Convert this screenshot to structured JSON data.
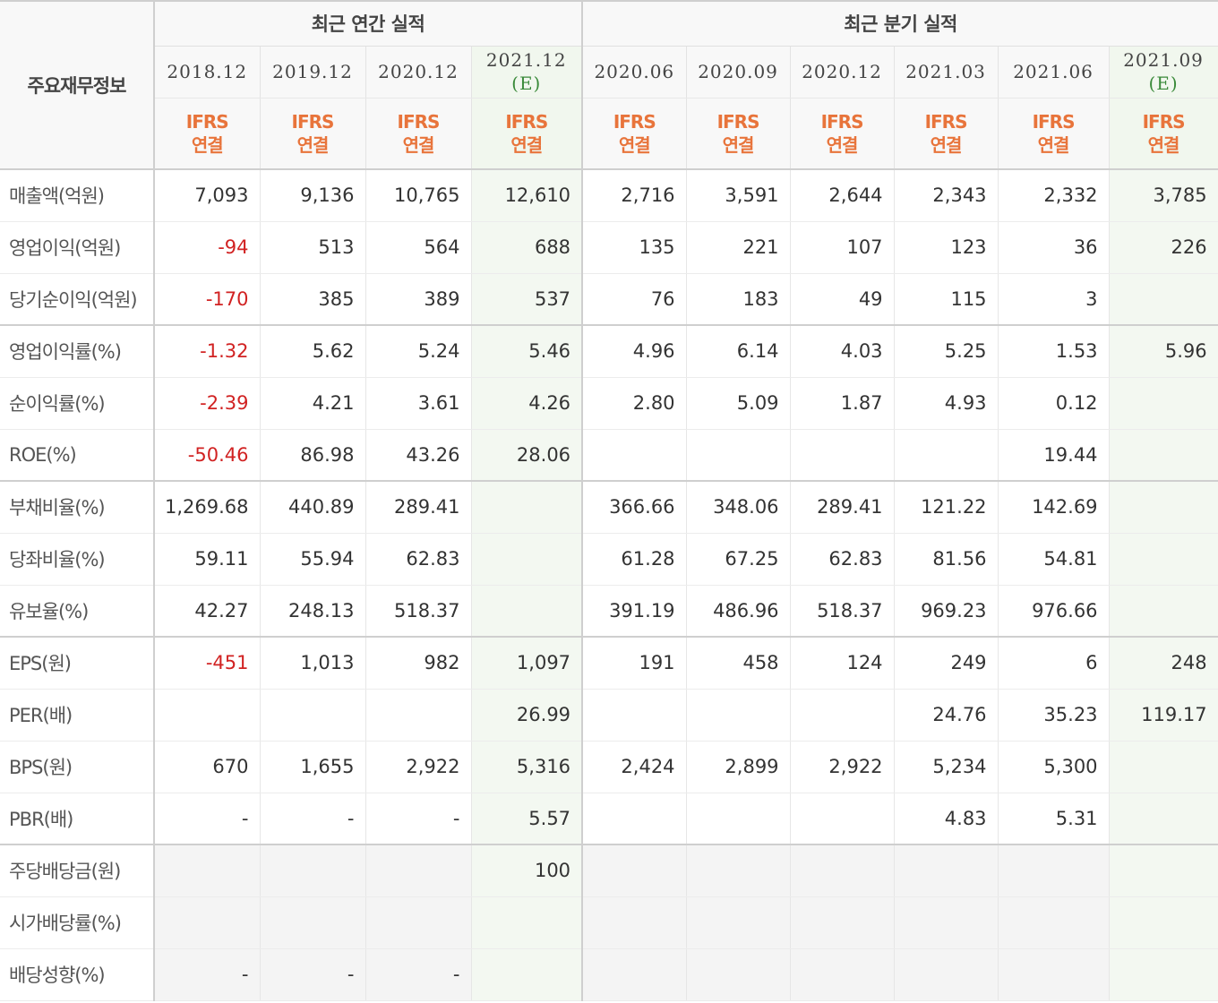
{
  "header": {
    "label": "주요재무정보",
    "annual_group": "최근 연간 실적",
    "quarterly_group": "최근 분기 실적",
    "ifrs_line1": "IFRS",
    "ifrs_line2": "연결",
    "periods": [
      {
        "date": "2018.12",
        "est": ""
      },
      {
        "date": "2019.12",
        "est": ""
      },
      {
        "date": "2020.12",
        "est": ""
      },
      {
        "date": "2021.12",
        "est": "(E)"
      },
      {
        "date": "2020.06",
        "est": ""
      },
      {
        "date": "2020.09",
        "est": ""
      },
      {
        "date": "2020.12",
        "est": ""
      },
      {
        "date": "2021.03",
        "est": ""
      },
      {
        "date": "2021.06",
        "est": ""
      },
      {
        "date": "2021.09",
        "est": "(E)"
      }
    ]
  },
  "rows": [
    {
      "label": "매출액(억원)",
      "values": [
        "7,093",
        "9,136",
        "10,765",
        "12,610",
        "2,716",
        "3,591",
        "2,644",
        "2,343",
        "2,332",
        "3,785"
      ]
    },
    {
      "label": "영업이익(억원)",
      "values": [
        "-94",
        "513",
        "564",
        "688",
        "135",
        "221",
        "107",
        "123",
        "36",
        "226"
      ]
    },
    {
      "label": "당기순이익(억원)",
      "values": [
        "-170",
        "385",
        "389",
        "537",
        "76",
        "183",
        "49",
        "115",
        "3",
        ""
      ]
    },
    {
      "label": "영업이익률(%)",
      "values": [
        "-1.32",
        "5.62",
        "5.24",
        "5.46",
        "4.96",
        "6.14",
        "4.03",
        "5.25",
        "1.53",
        "5.96"
      ]
    },
    {
      "label": "순이익률(%)",
      "values": [
        "-2.39",
        "4.21",
        "3.61",
        "4.26",
        "2.80",
        "5.09",
        "1.87",
        "4.93",
        "0.12",
        ""
      ]
    },
    {
      "label": "ROE(%)",
      "values": [
        "-50.46",
        "86.98",
        "43.26",
        "28.06",
        "",
        "",
        "",
        "",
        "19.44",
        ""
      ]
    },
    {
      "label": "부채비율(%)",
      "values": [
        "1,269.68",
        "440.89",
        "289.41",
        "",
        "366.66",
        "348.06",
        "289.41",
        "121.22",
        "142.69",
        ""
      ]
    },
    {
      "label": "당좌비율(%)",
      "values": [
        "59.11",
        "55.94",
        "62.83",
        "",
        "61.28",
        "67.25",
        "62.83",
        "81.56",
        "54.81",
        ""
      ]
    },
    {
      "label": "유보율(%)",
      "values": [
        "42.27",
        "248.13",
        "518.37",
        "",
        "391.19",
        "486.96",
        "518.37",
        "969.23",
        "976.66",
        ""
      ]
    },
    {
      "label": "EPS(원)",
      "values": [
        "-451",
        "1,013",
        "982",
        "1,097",
        "191",
        "458",
        "124",
        "249",
        "6",
        "248"
      ]
    },
    {
      "label": "PER(배)",
      "values": [
        "",
        "",
        "",
        "26.99",
        "",
        "",
        "",
        "24.76",
        "35.23",
        "119.17"
      ]
    },
    {
      "label": "BPS(원)",
      "values": [
        "670",
        "1,655",
        "2,922",
        "5,316",
        "2,424",
        "2,899",
        "2,922",
        "5,234",
        "5,300",
        ""
      ]
    },
    {
      "label": "PBR(배)",
      "values": [
        "-",
        "-",
        "-",
        "5.57",
        "",
        "",
        "",
        "4.83",
        "5.31",
        ""
      ]
    },
    {
      "label": "주당배당금(원)",
      "values": [
        "",
        "",
        "",
        "100",
        "",
        "",
        "",
        "",
        "",
        ""
      ]
    },
    {
      "label": "시가배당률(%)",
      "values": [
        "",
        "",
        "",
        "",
        "",
        "",
        "",
        "",
        "",
        ""
      ]
    },
    {
      "label": "배당성향(%)",
      "values": [
        "-",
        "-",
        "-",
        "",
        "",
        "",
        "",
        "",
        "",
        ""
      ]
    }
  ],
  "negative_color": "#d12222",
  "ifrs_color": "#e8743b",
  "estimate_color": "#3a8a3a"
}
